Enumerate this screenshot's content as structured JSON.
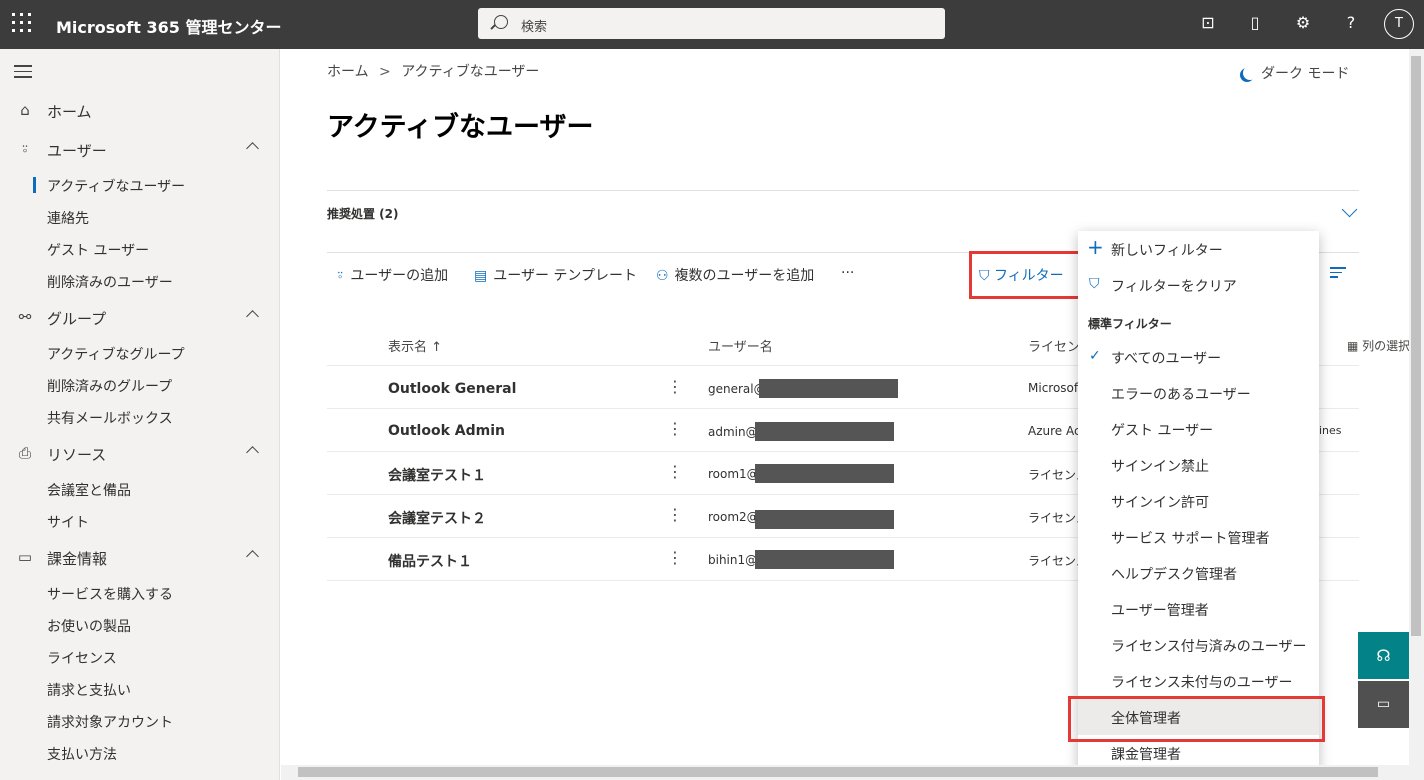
{
  "topbar": {
    "app_title": "Microsoft 365 管理センター",
    "search_placeholder": "検索",
    "avatar_initial": "T"
  },
  "sidebar": {
    "home": "ホーム",
    "users": "ユーザー",
    "users_items": [
      "アクティブなユーザー",
      "連絡先",
      "ゲスト ユーザー",
      "削除済みのユーザー"
    ],
    "groups": "グループ",
    "groups_items": [
      "アクティブなグループ",
      "削除済みのグループ",
      "共有メールボックス"
    ],
    "resources": "リソース",
    "resources_items": [
      "会議室と備品",
      "サイト"
    ],
    "billing": "課金情報",
    "billing_items": [
      "サービスを購入する",
      "お使いの製品",
      "ライセンス",
      "請求と支払い",
      "請求対象アカウント",
      "支払い方法"
    ]
  },
  "main": {
    "breadcrumb_home": "ホーム",
    "breadcrumb_sep": ">",
    "breadcrumb_current": "アクティブなユーザー",
    "dark_mode": "ダーク モード",
    "page_title": "アクティブなユーザー",
    "recommended": "推奨処置 (2)",
    "commands": {
      "add_user": "ユーザーの追加",
      "user_template": "ユーザー テンプレート",
      "add_multiple": "複数のユーザーを追加",
      "more": "···",
      "filter": "フィルター"
    },
    "columns": {
      "display_name": "表示名 ↑",
      "username": "ユーザー名",
      "license": "ライセンス",
      "choose_columns": "列の選択"
    },
    "rows": [
      {
        "name": "Outlook General",
        "user": "general@",
        "license": "Microsoft"
      },
      {
        "name": "Outlook Admin",
        "user": "admin@a",
        "license": "Azure Act",
        "extra": "ines"
      },
      {
        "name": "会議室テスト１",
        "user": "room1@",
        "license": "ライセンス"
      },
      {
        "name": "会議室テスト２",
        "user": "room2@",
        "license": "ライセンス"
      },
      {
        "name": "備品テスト１",
        "user": "bihin1@",
        "license": "ライセンス"
      }
    ]
  },
  "filter_menu": {
    "new_filter": "新しいフィルター",
    "clear_filter": "フィルターをクリア",
    "standard_header": "標準フィルター",
    "items": [
      "すべてのユーザー",
      "エラーのあるユーザー",
      "ゲスト ユーザー",
      "サインイン禁止",
      "サインイン許可",
      "サービス サポート管理者",
      "ヘルプデスク管理者",
      "ユーザー管理者",
      "ライセンス付与済みのユーザー",
      "ライセンス未付与のユーザー",
      "全体管理者",
      "課金管理者"
    ],
    "selected": "すべてのユーザー",
    "highlighted": "全体管理者"
  },
  "colors": {
    "accent": "#0f6cbd",
    "highlight_box": "#e53935",
    "topbar": "#3c3c3c"
  }
}
